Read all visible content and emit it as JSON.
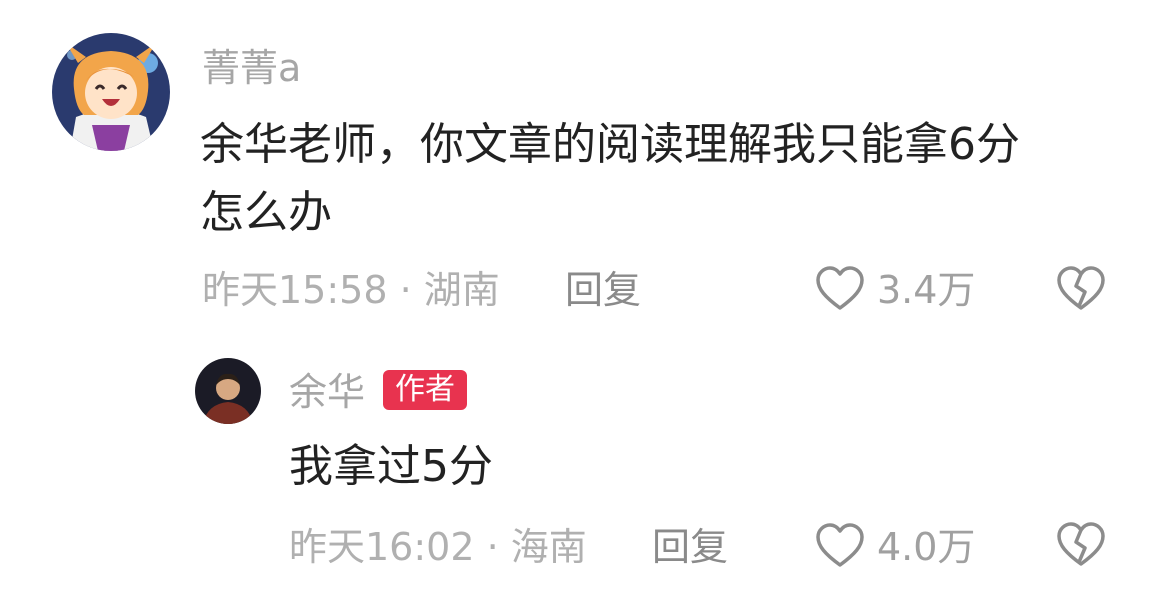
{
  "comment": {
    "username": "菁菁a",
    "text_line1": "余华老师，你文章的阅读理解我只能拿6分",
    "text_line2": "怎么办",
    "meta": "昨天15:58 · 湖南",
    "reply_label": "回复",
    "like_count": "3.4万"
  },
  "reply": {
    "username": "余华",
    "badge": "作者",
    "text": "我拿过5分",
    "meta": "昨天16:02 · 海南",
    "reply_label": "回复",
    "like_count": "4.0万"
  },
  "colors": {
    "badge_bg": "#e8334f",
    "muted_text": "#a6a6a6",
    "icon_gray": "#8c8c8c"
  },
  "icons": [
    "heart-icon",
    "broken-heart-icon"
  ]
}
